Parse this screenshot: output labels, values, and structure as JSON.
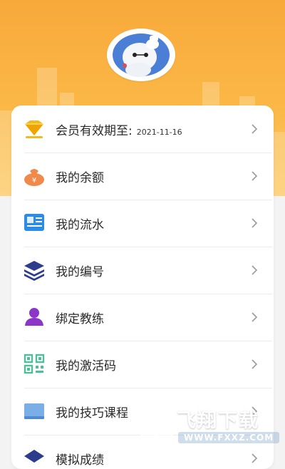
{
  "profile": {
    "avatar_icon": "baymax-avatar-icon"
  },
  "menu": {
    "items": [
      {
        "label": "会员有效期至:",
        "value": "2021-11-16",
        "icon": "diamond-icon",
        "color": "#f5b81d"
      },
      {
        "label": "我的余额",
        "icon": "money-bag-icon",
        "color": "#f08a4b"
      },
      {
        "label": "我的流水",
        "icon": "ledger-icon",
        "color": "#2b8be8"
      },
      {
        "label": "我的编号",
        "icon": "layers-icon",
        "color": "#2d3c8c"
      },
      {
        "label": "绑定教练",
        "icon": "coach-icon",
        "color": "#8b35c9"
      },
      {
        "label": "我的激活码",
        "icon": "qr-code-icon",
        "color": "#4fbf9a"
      },
      {
        "label": "我的技巧课程",
        "icon": "course-book-icon",
        "color": "#7aaee6"
      },
      {
        "label": "模拟成绩",
        "icon": "score-icon",
        "color": "#2d3c8c"
      }
    ]
  },
  "watermark": {
    "text": "飞翔下载",
    "url": "WWW.FXXZ.COM"
  },
  "colors": {
    "header_orange": "#f8a93a",
    "background": "#f3f3f3"
  }
}
